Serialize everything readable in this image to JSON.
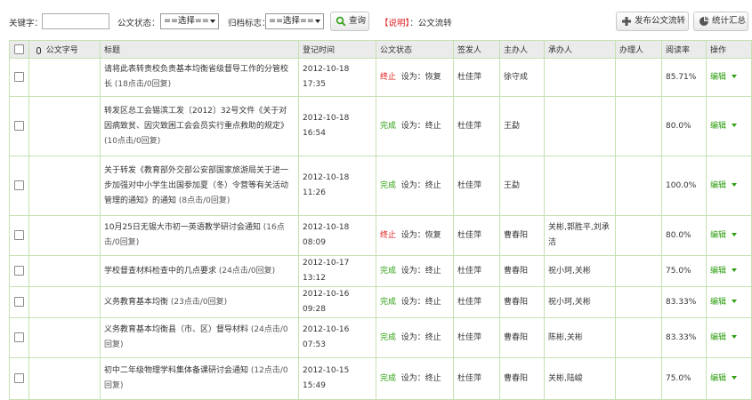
{
  "toolbar": {
    "keyword_label": "关键字：",
    "keyword_value": "",
    "status_label": "公文状态：",
    "status_select": "==选择==",
    "archive_label": "归档标志：",
    "archive_select": "==选择==",
    "query_button": "查询",
    "note_key": "【说明】",
    "note_text": "：公文流转",
    "publish_button": "发布公文流转",
    "stats_button": "统计汇总"
  },
  "table": {
    "headers": {
      "doc_no": "公文字号",
      "title": "标题",
      "reg_time": "登记时间",
      "status": "公文状态",
      "signer": "签发人",
      "host": "主办人",
      "undertaker": "承办人",
      "handler": "办理人",
      "read_rate": "阅读率",
      "action": "操作"
    },
    "rows": [
      {
        "title": "请将此表转责校负责基本均衡省级督导工作的分管校长",
        "count": "(18点击/0回复)",
        "time": "2012-10-18 17:35",
        "status": "终止",
        "set": "设为：恢复",
        "signer": "杜佳萍",
        "host": "徐守成",
        "undertaker": "",
        "handler": "",
        "rate": "85.71%",
        "edit": "编辑"
      },
      {
        "title": "转发区总工会锡滨工发〔2012〕32号文件《关于对因病致贫、因灾致困工会会员实行重点救助的规定》",
        "count": "(10点击/0回复)",
        "time": "2012-10-18 16:54",
        "status": "完成",
        "set": "设为：终止",
        "signer": "杜佳萍",
        "host": "王勐",
        "undertaker": "",
        "handler": "",
        "rate": "80.0%",
        "edit": "编辑"
      },
      {
        "title": "关于转发《教育部外交部公安部国家旅游局关于进一步加强对中小学生出国参加夏（冬）令营等有关活动管理的通知》的通知",
        "count": "(8点击/0回复)",
        "time": "2012-10-18 11:26",
        "status": "完成",
        "set": "设为：终止",
        "signer": "杜佳萍",
        "host": "王勐",
        "undertaker": "",
        "handler": "",
        "rate": "100.0%",
        "edit": "编辑"
      },
      {
        "title": "10月25日无锡大市初一英语教学研讨会通知",
        "count": "(16点击/0回复)",
        "time": "2012-10-18 08:09",
        "status": "终止",
        "set": "设为：恢复",
        "signer": "杜佳萍",
        "host": "曹春阳",
        "undertaker": "关彬,郭胜平,刘承洁",
        "handler": "",
        "rate": "80.0%",
        "edit": "编辑"
      },
      {
        "title": "学校督查材料检查中的几点要求",
        "count": "(24点击/0回复)",
        "time": "2012-10-17 13:12",
        "status": "完成",
        "set": "设为：终止",
        "signer": "杜佳萍",
        "host": "曹春阳",
        "undertaker": "祝小珂,关彬",
        "handler": "",
        "rate": "75.0%",
        "edit": "编辑"
      },
      {
        "title": "义务教育基本均衡",
        "count": "(23点击/0回复)",
        "time": "2012-10-16 09:28",
        "status": "完成",
        "set": "设为：终止",
        "signer": "杜佳萍",
        "host": "曹春阳",
        "undertaker": "祝小珂,关彬",
        "handler": "",
        "rate": "83.33%",
        "edit": "编辑"
      },
      {
        "title": "义务教育基本均衡县（市、区）督导材料",
        "count": "(24点击/0回复)",
        "time": "2012-10-16 07:53",
        "status": "完成",
        "set": "设为：终止",
        "signer": "杜佳萍",
        "host": "曹春阳",
        "undertaker": "陈彬,关彬",
        "handler": "",
        "rate": "83.33%",
        "edit": "编辑"
      },
      {
        "title": "初中二年级物理学科集体备课研讨会通知",
        "count": "(12点击/0回复)",
        "time": "2012-10-15 15:49",
        "status": "完成",
        "set": "设为：终止",
        "signer": "杜佳萍",
        "host": "曹春阳",
        "undertaker": "关彬,陆峻",
        "handler": "",
        "rate": "75.0%",
        "edit": "编辑"
      }
    ]
  }
}
